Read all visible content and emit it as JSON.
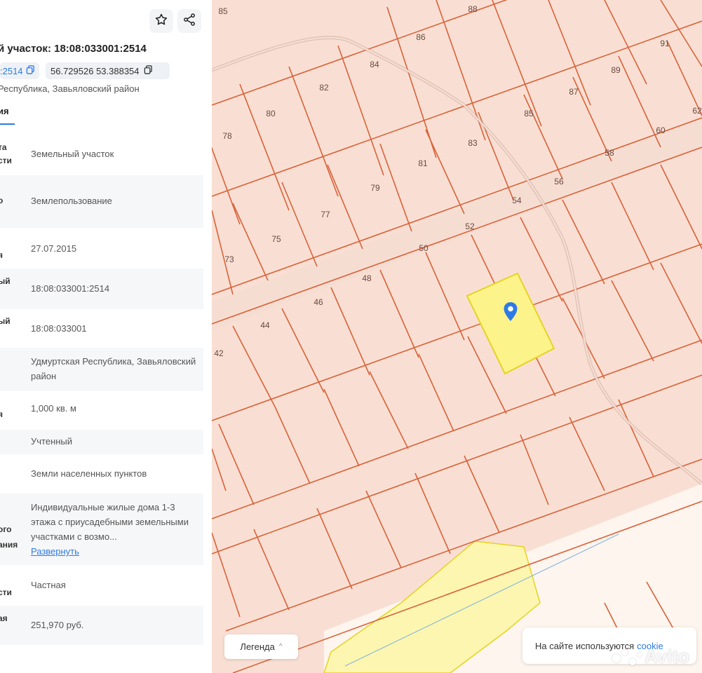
{
  "panel": {
    "title": "й участок: 18:08:033001:2514",
    "cad_chip": ":2514",
    "coords_chip": "56.729526 53.388354",
    "address_line": "Республика, Завьяловский район",
    "tab": "ия",
    "rows": [
      {
        "label": [
          "та",
          "сти"
        ],
        "value": "Земельный участок"
      },
      {
        "label": [
          "о"
        ],
        "value": "Землепользование"
      },
      {
        "label": [
          "я"
        ],
        "value": "27.07.2015"
      },
      {
        "label": [
          "ый"
        ],
        "value": "18:08:033001:2514"
      },
      {
        "label": [
          "ый"
        ],
        "value": "18:08:033001"
      },
      {
        "label": [],
        "value": "Удмуртская Республика, Завьяловский район"
      },
      {
        "label": [
          "я"
        ],
        "value": "1,000 кв. м"
      },
      {
        "label": [],
        "value": "Учтенный"
      },
      {
        "label": [],
        "value": "Земли населенных пунктов"
      },
      {
        "label": [
          "ого",
          "ания"
        ],
        "value": "Индивидуальные жилые дома 1-3 этажа с приусадебными земельными участками с возмо...",
        "expand": "Развернуть"
      },
      {
        "label": [
          "сти"
        ],
        "value": "Частная"
      },
      {
        "label": [
          "ая"
        ],
        "value": "251,970 руб."
      }
    ]
  },
  "map": {
    "plot_numbers": [
      "85",
      "88",
      "86",
      "91",
      "84",
      "82",
      "89",
      "87",
      "80",
      "85",
      "62",
      "78",
      "60",
      "83",
      "58",
      "81",
      "56",
      "79",
      "54",
      "77",
      "52",
      "75",
      "50",
      "73",
      "48",
      "46",
      "44",
      "42"
    ],
    "legend": "Легенда",
    "cookie_text": "На сайте используются",
    "cookie_link": "cookie",
    "watermark": "Avito",
    "colors": {
      "parcel_fill": "#f9dfd3",
      "parcel_border": "#d9623a",
      "selected_fill": "#fcf38a",
      "selected_border": "#e6d321",
      "marker": "#2c7be5"
    }
  }
}
